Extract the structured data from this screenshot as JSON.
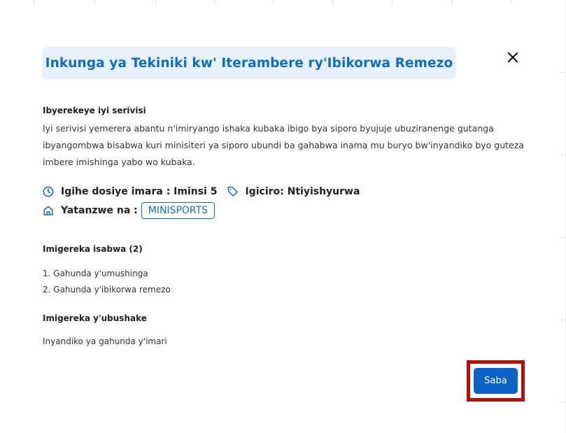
{
  "modal": {
    "title": "Inkunga ya Tekiniki kw' Iterambere ry'Ibikorwa Remezo",
    "close_icon": "close-icon"
  },
  "about": {
    "heading": "Ibyerekeye iyi serivisi",
    "text": "Iyi serivisi yemerera abantu n'imiryango ishaka kubaka ibigo bya siporo byujuje ubuziranenge gutanga ibyangombwa bisabwa kuri minisiteri ya siporo ubundi ba gahabwa inama mu buryo bw'inyandiko byo guteza imbere imishinga yabo wo kubaka."
  },
  "meta": {
    "duration_icon": "clock-icon",
    "duration_label": "Igihe dosiye imara : Iminsi 5",
    "price_icon": "tag-icon",
    "price_label": "Igiciro: Ntiyishyurwa",
    "provider_icon": "building-icon",
    "provider_label": "Yatanzwe na :",
    "provider_badge": "MINISPORTS"
  },
  "required": {
    "heading": "Imigereka isabwa (2)",
    "items": [
      "1. Gahunda y'umushinga",
      "2. Gahunda y'ibikorwa remezo"
    ]
  },
  "optional": {
    "heading": "Imigereka y'ubushake",
    "text": "Inyandiko ya gahunda y'imari"
  },
  "actions": {
    "apply_label": "Saba"
  },
  "colors": {
    "accent": "#0f6cc4",
    "title_bg": "#e7f1fb",
    "button_bg": "#0b63c9",
    "highlight": "#bf0a0a"
  }
}
